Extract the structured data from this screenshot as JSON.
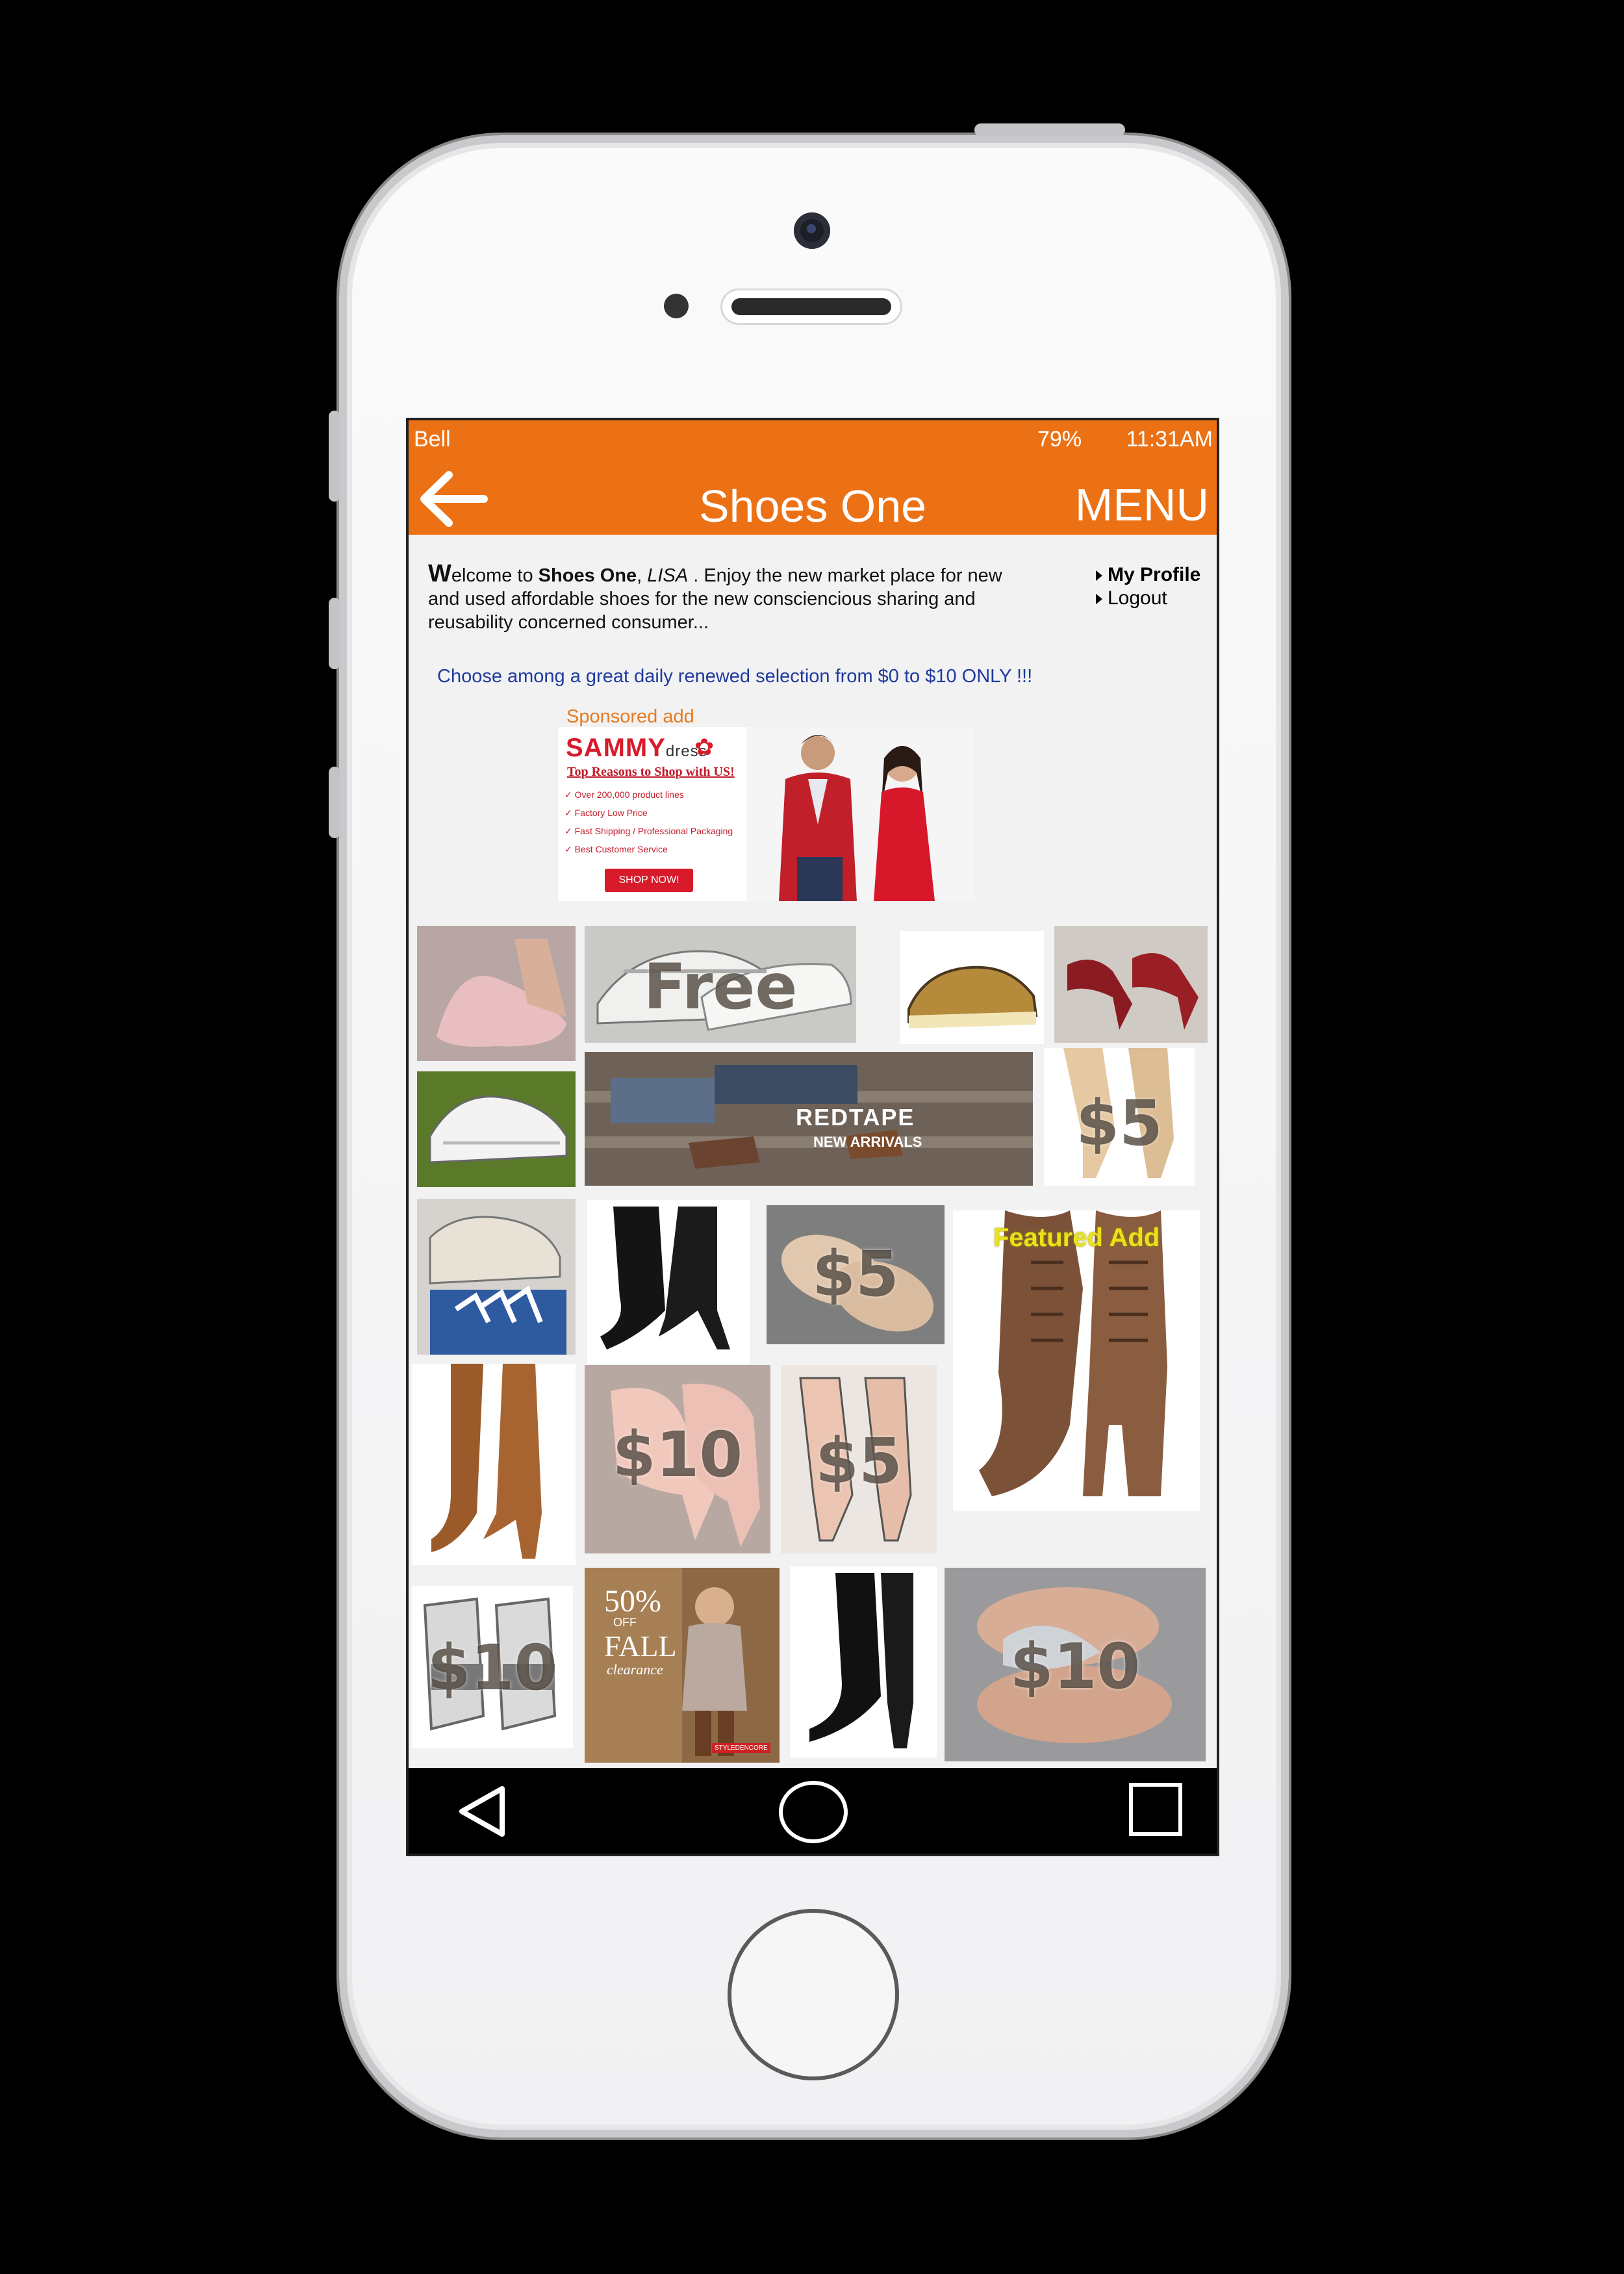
{
  "status_bar": {
    "carrier": "Bell",
    "battery": "79%",
    "time": "11:31AM"
  },
  "app_bar": {
    "title": "Shoes One",
    "menu_label": "MENU"
  },
  "welcome": {
    "first_letter": "W",
    "text_1": "elcome to ",
    "brand": "Shoes One",
    "comma": ", ",
    "user": "LISA",
    "text_2": " . Enjoy the new market place for new and used affordable shoes for the  new consciencious sharing and reusability concerned consumer..."
  },
  "profile_menu": {
    "my_profile": "My Profile",
    "logout": "Logout"
  },
  "promo_text": "Choose among a great daily renewed selection from $0 to $10 ONLY !!!",
  "sponsored": {
    "label": "Sponsored add",
    "brand_main": "SAMMY",
    "brand_suffix": "dress",
    "headline": "Top Reasons to Shop with US!",
    "reasons": [
      "Over 200,000 product lines",
      "Factory Low Price",
      "Fast Shipping / Professional Packaging",
      "Best Customer Service"
    ],
    "button": "SHOP NOW!"
  },
  "tiles": {
    "free": "Free",
    "price_5_a": "$5",
    "price_5_b": "$5",
    "price_5_c": "$5",
    "price_10_a": "$10",
    "price_10_b": "$10",
    "price_10_c": "$10",
    "redtape_brand": "REDTAPE",
    "redtape_sub": "NEW ARRIVALS",
    "featured": "Featured Add",
    "clearance_pct": "50%",
    "clearance_off": "OFF",
    "clearance_fall": "FALL",
    "clearance_word": "clearance",
    "clearance_store": "STYLEDENCORE"
  },
  "colors": {
    "accent": "#ec7115",
    "promo_blue": "#1f3a9f",
    "featured_yellow": "#e9e219"
  }
}
